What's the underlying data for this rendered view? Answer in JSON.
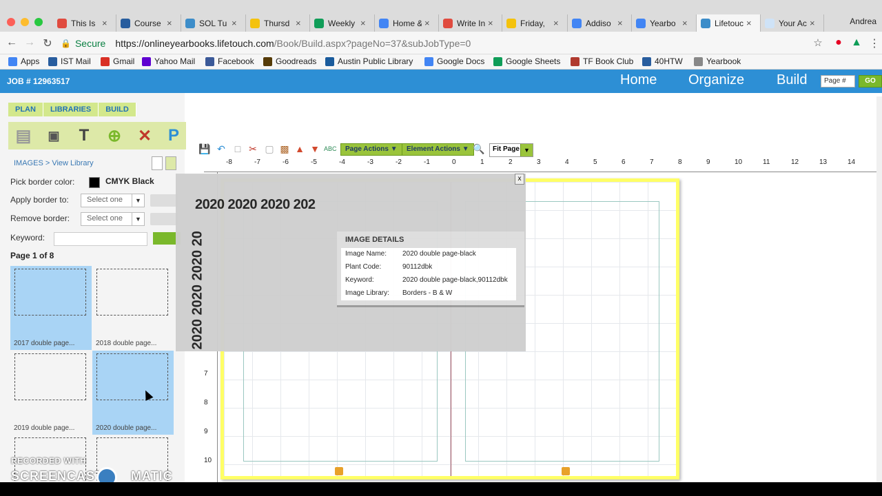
{
  "browser": {
    "tabs": [
      {
        "label": "This Is ",
        "icon_color": "#e04b3f"
      },
      {
        "label": "Course",
        "icon_color": "#285d9e"
      },
      {
        "label": "SOL Tu",
        "icon_color": "#3d8dc9"
      },
      {
        "label": "Thursd",
        "icon_color": "#f4c20d"
      },
      {
        "label": "Weekly",
        "icon_color": "#0f9d58"
      },
      {
        "label": "Home &",
        "icon_color": "#4285f4"
      },
      {
        "label": "Write In",
        "icon_color": "#e04b3f"
      },
      {
        "label": "Friday,",
        "icon_color": "#f4c20d"
      },
      {
        "label": "Addiso",
        "icon_color": "#4285f4"
      },
      {
        "label": "Yearbo",
        "icon_color": "#4285f4"
      },
      {
        "label": "Lifetouc",
        "icon_color": "#3d8dc9"
      },
      {
        "label": "Your Ac",
        "icon_color": "#cfe3f7"
      }
    ],
    "profile_name": "Andrea",
    "secure_label": "Secure",
    "url_base": "https://onlineyearbooks.lifetouch.com",
    "url_path": "/Book/Build.aspx?pageNo=37&subJobType=0",
    "bookmarks": [
      {
        "label": "Apps",
        "icon_color": "#4285f4"
      },
      {
        "label": "IST Mail",
        "icon_color": "#285d9e"
      },
      {
        "label": "Gmail",
        "icon_color": "#d93025"
      },
      {
        "label": "Yahoo Mail",
        "icon_color": "#5f01d1"
      },
      {
        "label": "Facebook",
        "icon_color": "#3b5998"
      },
      {
        "label": "Goodreads",
        "icon_color": "#553b08"
      },
      {
        "label": "Austin Public Library",
        "icon_color": "#1a5b9c"
      },
      {
        "label": "Google Docs",
        "icon_color": "#4285f4"
      },
      {
        "label": "Google Sheets",
        "icon_color": "#0f9d58"
      },
      {
        "label": "TF Book Club",
        "icon_color": "#b03a2e"
      },
      {
        "label": "40HTW",
        "icon_color": "#285d9e"
      },
      {
        "label": "Yearbook",
        "icon_color": "#888888"
      }
    ]
  },
  "app": {
    "job_number": "JOB # 12963517",
    "nav": [
      "Home",
      "Organize",
      "Build"
    ],
    "page_placeholder": "Page #",
    "go_label": "GO",
    "subtabs": [
      "PLAN",
      "LIBRARIES",
      "BUILD"
    ],
    "breadcrumb": "IMAGES > View Library",
    "pick_border_label": "Pick border color:",
    "border_color_name": "CMYK Black",
    "apply_border_label": "Apply border to:",
    "remove_border_label": "Remove border:",
    "select_placeholder": "Select one",
    "keyword_label": "Keyword:",
    "page_of": "Page 1 of 8",
    "thumbnails": [
      {
        "caption": "2017 double page...",
        "selected": true
      },
      {
        "caption": "2018 double page...",
        "selected": false
      },
      {
        "caption": "2019 double page...",
        "selected": false
      },
      {
        "caption": "2020 double page...",
        "selected": true
      },
      {
        "caption": "",
        "selected": false
      },
      {
        "caption": "",
        "selected": false
      }
    ]
  },
  "toolbar": {
    "page_actions": "Page Actions",
    "element_actions": "Element Actions",
    "zoom_option": "Fit Page"
  },
  "ruler": {
    "h_ticks": [
      "-8",
      "-7",
      "-6",
      "-5",
      "-4",
      "-3",
      "-2",
      "-1",
      "0",
      "1",
      "2",
      "3",
      "4",
      "5",
      "6",
      "7",
      "8",
      "9",
      "10",
      "11",
      "12",
      "13",
      "14"
    ],
    "v_ticks": [
      "7",
      "8",
      "9",
      "10"
    ]
  },
  "preview": {
    "sample_text": "2020 2020 2020 202",
    "vertical_text": "2020 2020 2020 20",
    "close_label": "x",
    "details_title": "IMAGE DETAILS",
    "details": [
      {
        "key": "Image Name:",
        "value": "2020 double page-black"
      },
      {
        "key": "Plant Code:",
        "value": "90112dbk"
      },
      {
        "key": "Keyword:",
        "value": "2020 double page-black,90112dbk"
      },
      {
        "key": "Image Library:",
        "value": "Borders - B & W"
      }
    ]
  },
  "watermark": {
    "line1": "RECORDED WITH",
    "line2a": "SCREENCAST",
    "line2b": "MATIC"
  }
}
